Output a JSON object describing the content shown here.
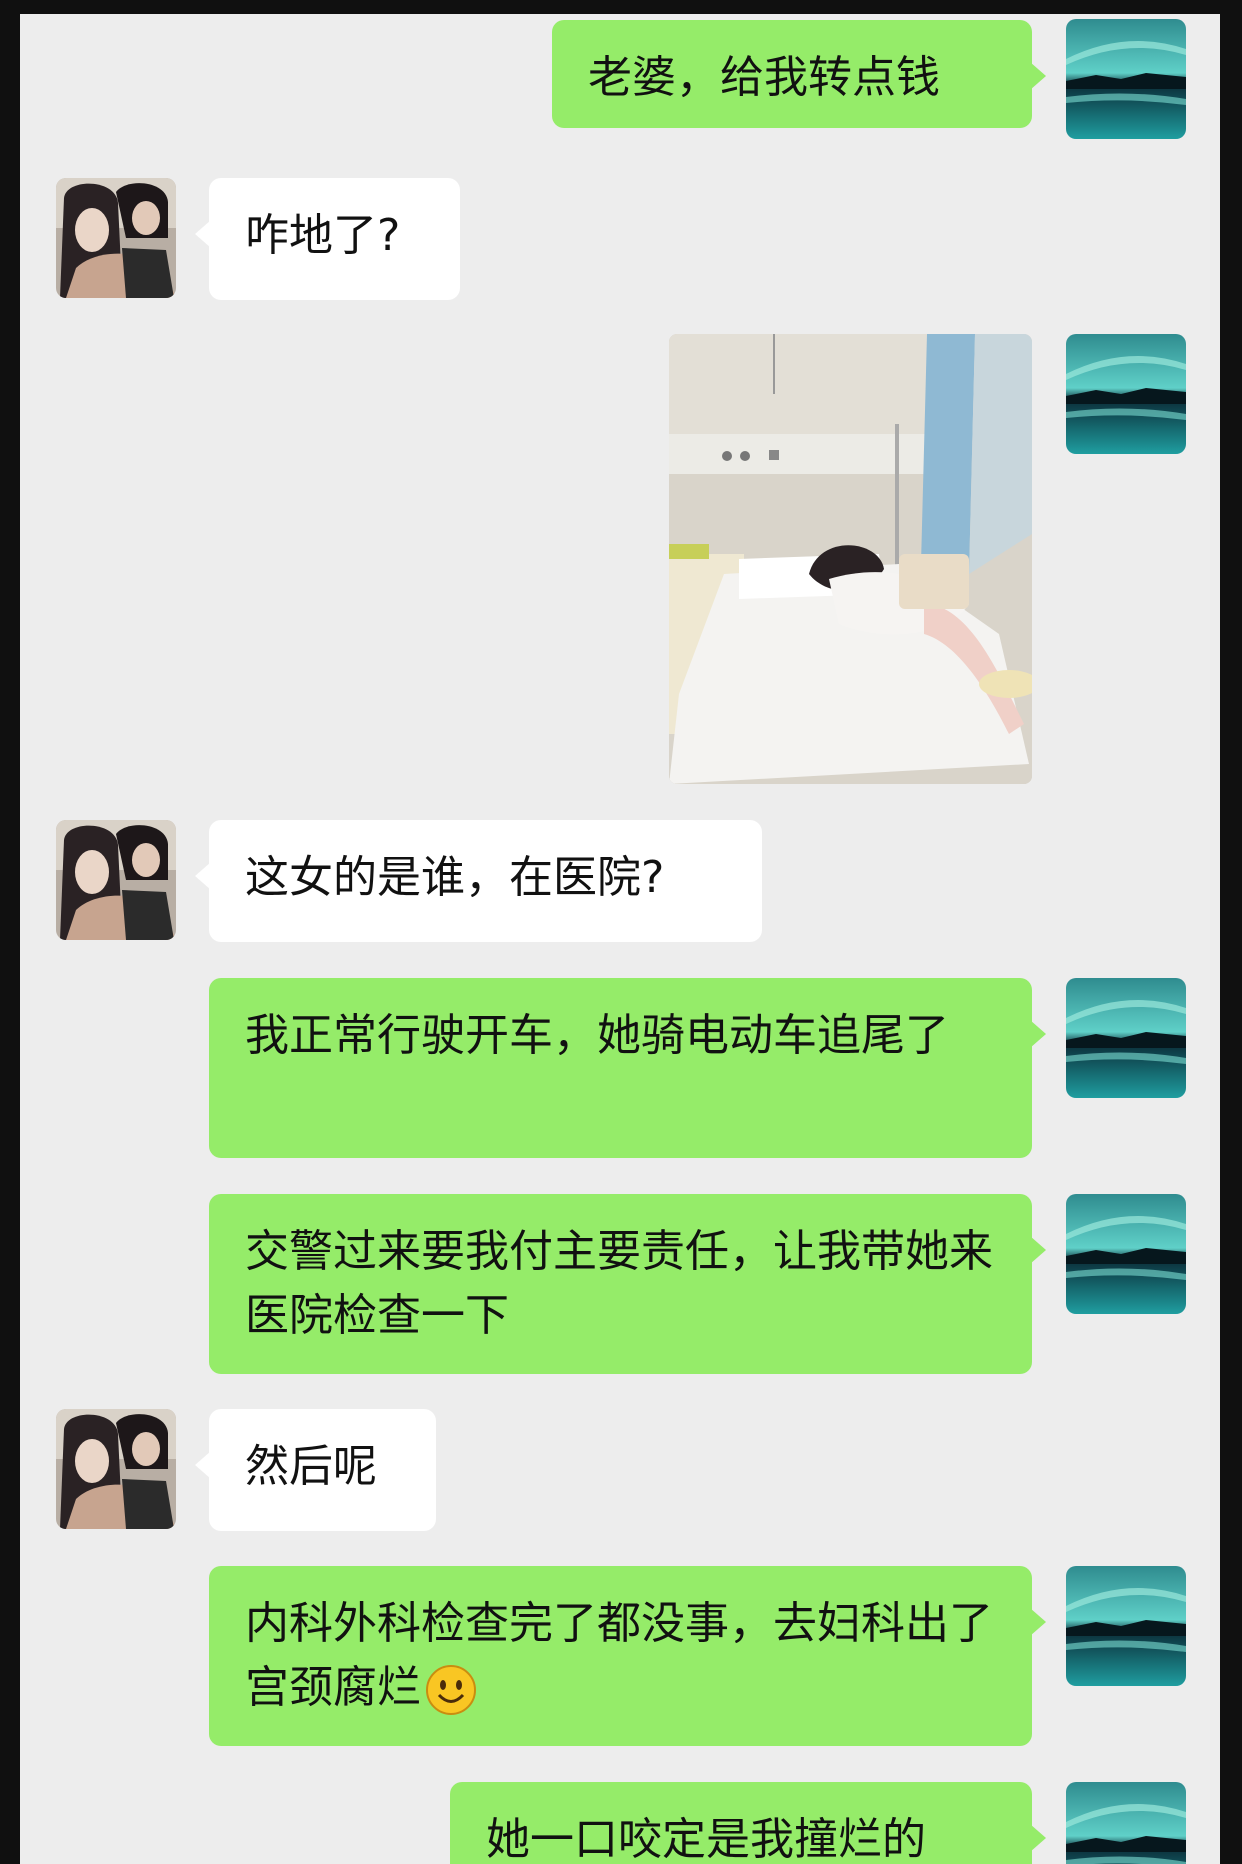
{
  "chat": {
    "messages": [
      {
        "side": "me",
        "text": "老婆，给我转点钱"
      },
      {
        "side": "other",
        "text": "咋地了?"
      },
      {
        "side": "me",
        "type": "image",
        "image": "hospital-bed-photo"
      },
      {
        "side": "other",
        "text": "这女的是谁，在医院?"
      },
      {
        "side": "me",
        "text": "我正常行驶开车，她骑电动车追尾了"
      },
      {
        "side": "me",
        "text": "交警过来要我付主要责任，让我带她来医院检查一下"
      },
      {
        "side": "other",
        "text": "然后呢"
      },
      {
        "side": "me",
        "text": "内科外科检查完了都没事，去妇科出了宫颈腐烂",
        "emoji": "smile-emoji"
      },
      {
        "side": "me",
        "text": "她一口咬定是我撞烂的"
      }
    ]
  },
  "avatars": {
    "me": "landscape-avatar",
    "other": "couple-avatar"
  },
  "colors": {
    "background": "#ededed",
    "my_bubble": "#95ec69",
    "their_bubble": "#ffffff"
  }
}
